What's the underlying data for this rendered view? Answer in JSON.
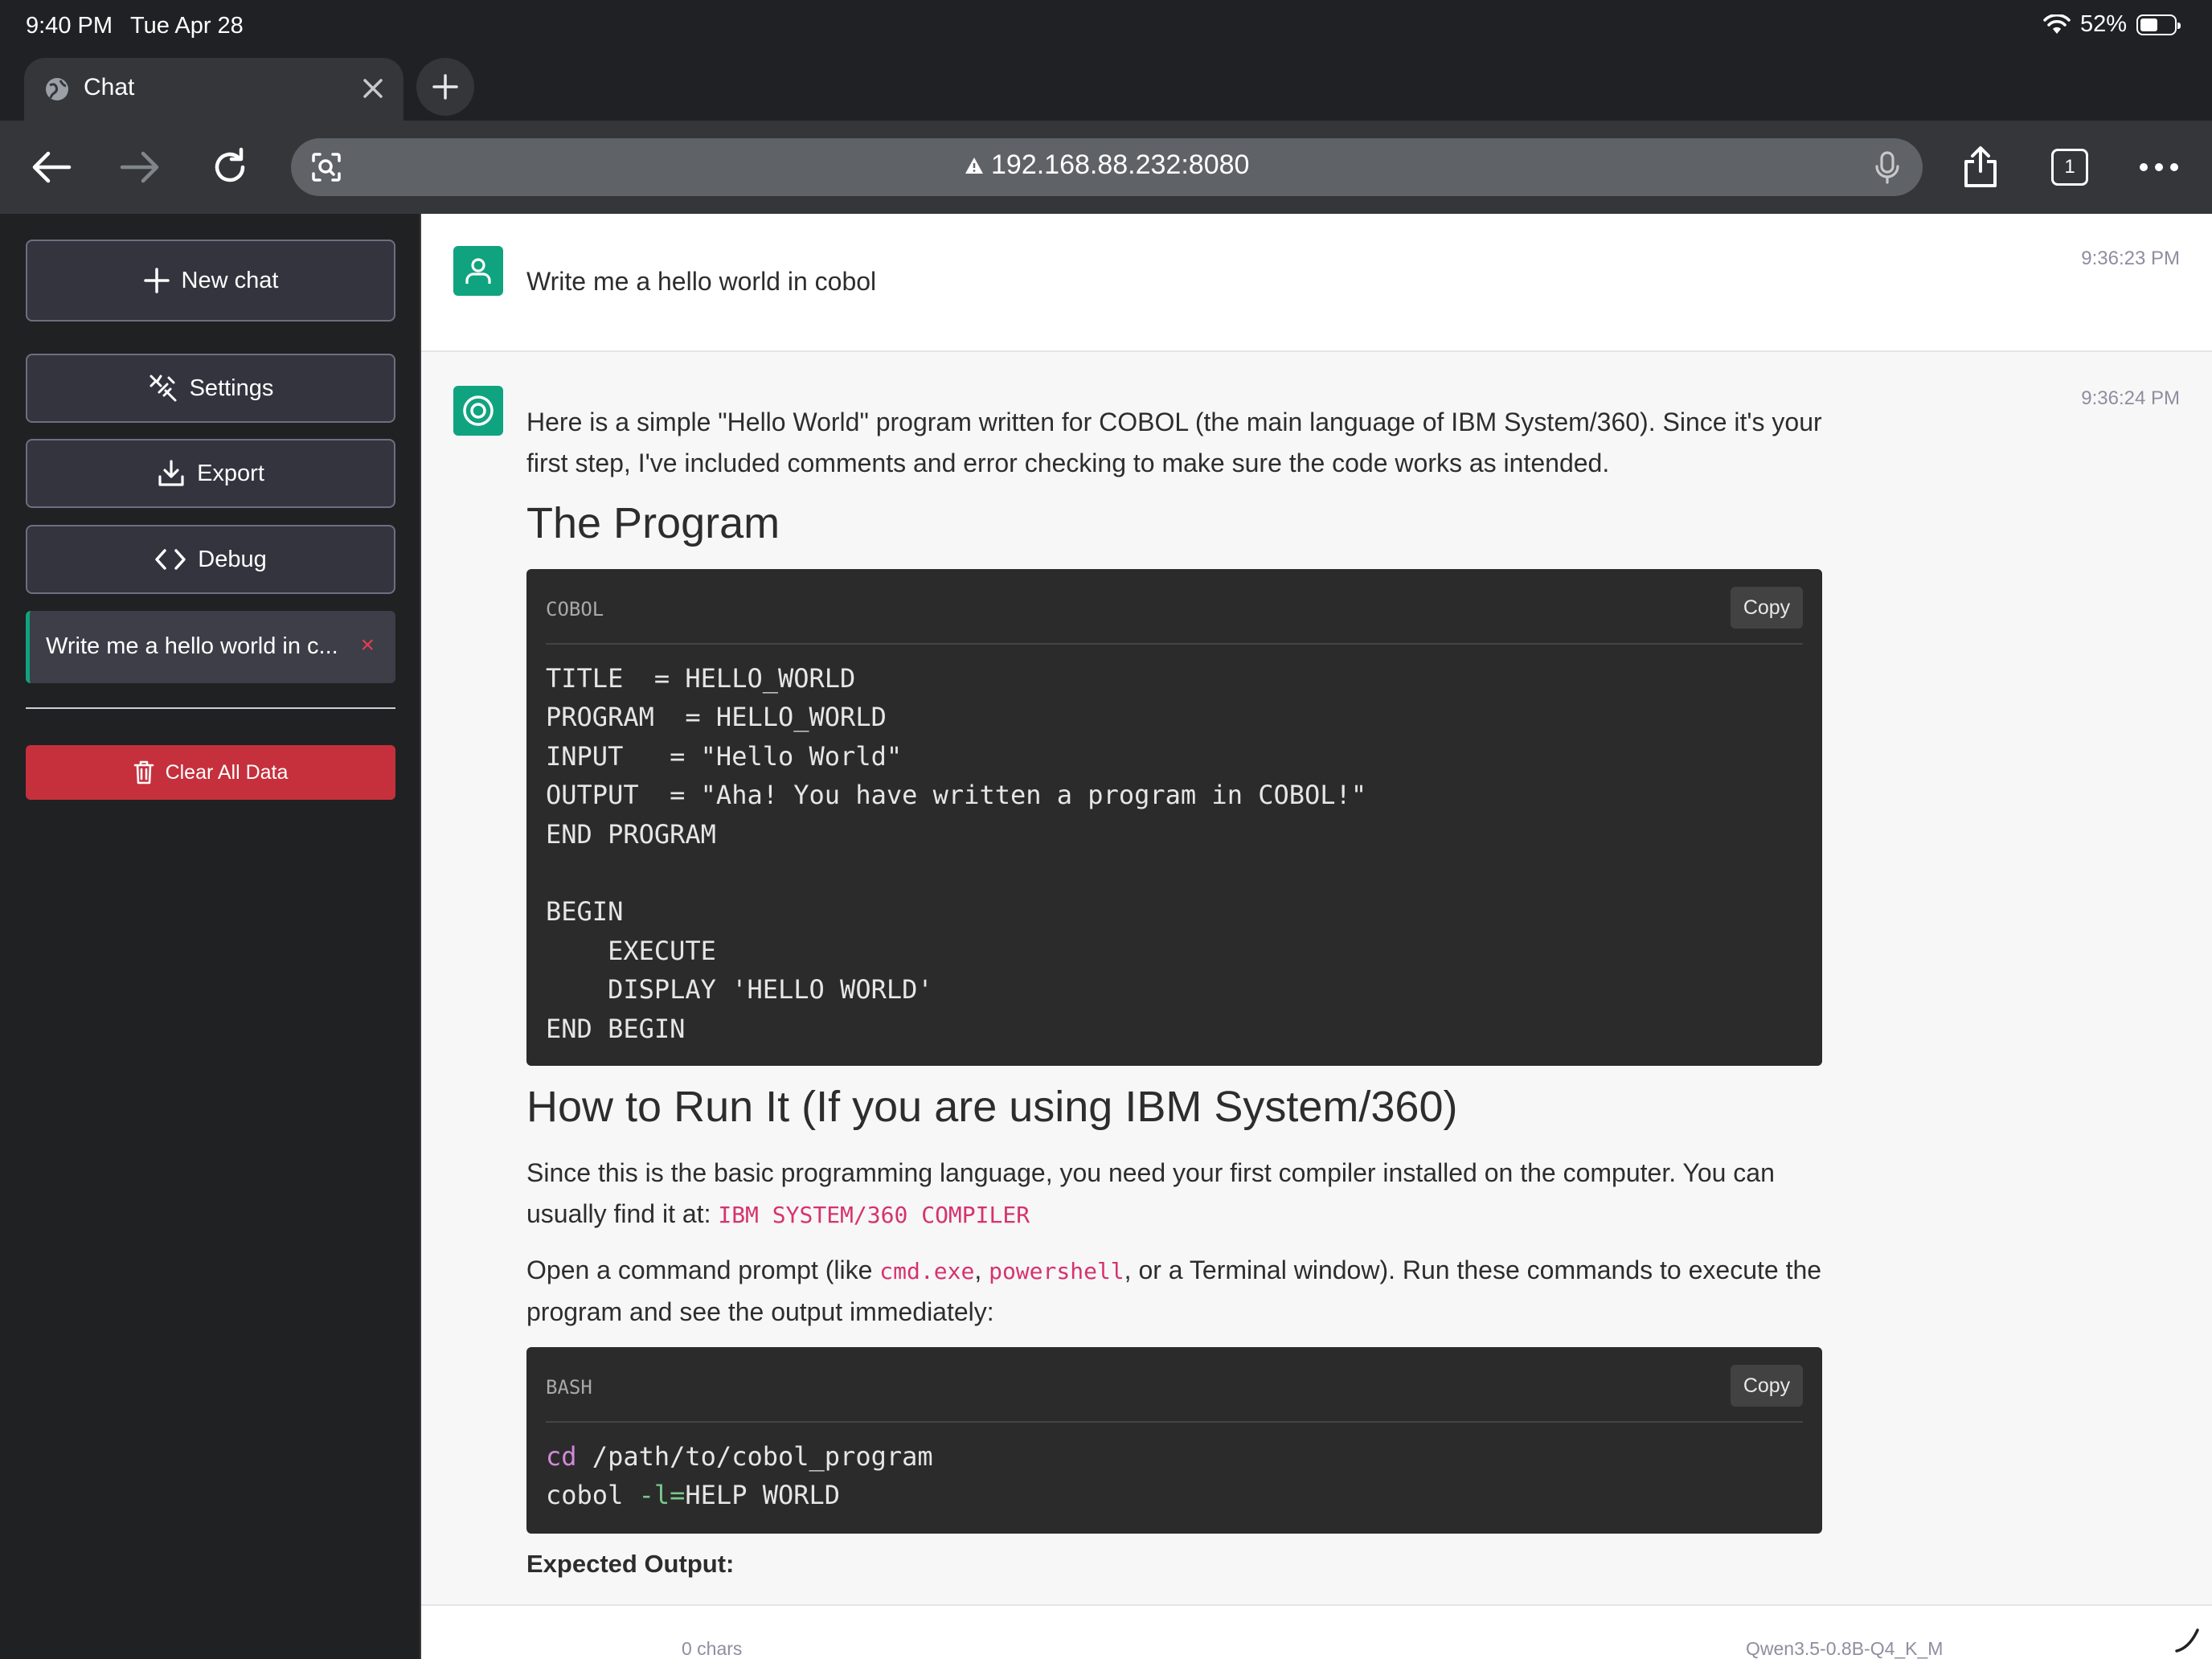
{
  "status_bar": {
    "time": "9:40 PM",
    "date": "Tue Apr 28",
    "battery": "52%",
    "battery_level": 0.52
  },
  "browser": {
    "tab_title": "Chat",
    "url": "192.168.88.232:8080",
    "open_tab_count": "1"
  },
  "sidebar": {
    "new_chat": "New chat",
    "settings": "Settings",
    "export": "Export",
    "debug": "Debug",
    "chat_item": "Write me a hello world in c...",
    "chat_item_delete": "×",
    "clear_all": "Clear All Data"
  },
  "conversation": {
    "user_message": {
      "text": "Write me a hello world in cobol",
      "time": "9:36:23 PM"
    },
    "assistant_message": {
      "time": "9:36:24 PM",
      "intro": "Here is a simple \"Hello World\" program written for COBOL (the main language of IBM System/360). Since it's your first step, I've included comments and error checking to make sure the code works as intended.",
      "heading_1": "The Program",
      "code_1": {
        "lang": "COBOL",
        "copy": "Copy",
        "code": "TITLE  = HELLO_WORLD\nPROGRAM  = HELLO_WORLD\nINPUT   = \"Hello World\"\nOUTPUT  = \"Aha! You have written a program in COBOL!\"\nEND PROGRAM\n\nBEGIN\n    EXECUTE\n    DISPLAY 'HELLO WORLD'\nEND BEGIN"
      },
      "heading_2": "How to Run It (If you are using IBM System/360)",
      "para_2_text": "Since this is the basic programming language, you need your first compiler installed on the computer. You can usually find it at: ",
      "para_2_code": "IBM SYSTEM/360 COMPILER",
      "para_3_a": "Open a command prompt (like ",
      "para_3_code_1": "cmd.exe",
      "para_3_b": ", ",
      "para_3_code_2": "powershell",
      "para_3_c": ", or a Terminal window). Run these commands to execute the program and see the output immediately:",
      "code_2": {
        "lang": "BASH",
        "copy": "Copy",
        "line_1_cmd": "cd",
        "line_1_rest": " /path/to/cobol_program",
        "line_2_cmd": "cobol ",
        "line_2_flag": "-l=",
        "line_2_rest": "HELP WORLD"
      },
      "expected_output_label": "Expected Output:"
    }
  },
  "footer": {
    "char_count": "0 chars",
    "model": "Qwen3.5-0.8B-Q4_K_M"
  },
  "colors": {
    "accent": "#10a37f",
    "danger": "#c5303c",
    "inline_code": "#d6336c"
  }
}
